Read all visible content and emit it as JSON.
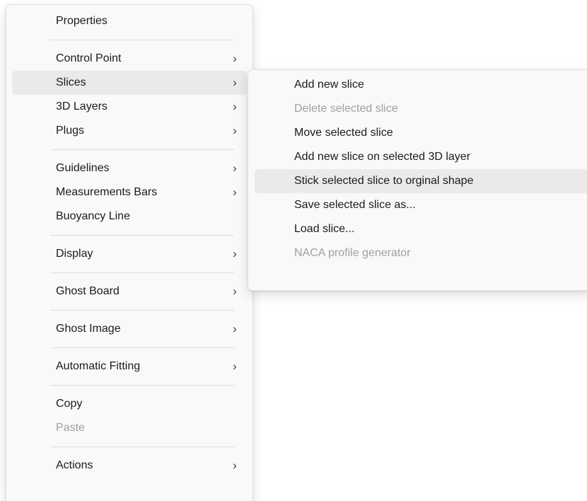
{
  "main_menu": {
    "items": [
      {
        "label": "Properties"
      },
      {
        "label": "Control Point",
        "arrow": "›"
      },
      {
        "label": "Slices",
        "arrow": "›"
      },
      {
        "label": "3D Layers",
        "arrow": "›"
      },
      {
        "label": "Plugs",
        "arrow": "›"
      },
      {
        "label": "Guidelines",
        "arrow": "›"
      },
      {
        "label": "Measurements Bars",
        "arrow": "›"
      },
      {
        "label": "Buoyancy Line"
      },
      {
        "label": "Display",
        "arrow": "›"
      },
      {
        "label": "Ghost Board",
        "arrow": "›"
      },
      {
        "label": "Ghost Image",
        "arrow": "›"
      },
      {
        "label": "Automatic Fitting",
        "arrow": "›"
      },
      {
        "label": "Copy"
      },
      {
        "label": "Paste"
      },
      {
        "label": "Actions",
        "arrow": "›"
      }
    ]
  },
  "slices_submenu": {
    "items": [
      {
        "label": "Add new slice"
      },
      {
        "label": "Delete selected slice"
      },
      {
        "label": "Move selected slice"
      },
      {
        "label": "Add new slice on selected 3D layer"
      },
      {
        "label": "Stick selected slice to orginal shape"
      },
      {
        "label": "Save selected slice as..."
      },
      {
        "label": "Load slice..."
      },
      {
        "label": "NACA profile generator"
      }
    ]
  },
  "colors": {
    "menu_background": "#f9f9f9",
    "highlight": "#eaeaea",
    "disabled_text": "#a0a0a0",
    "text": "#1b1b1b"
  }
}
